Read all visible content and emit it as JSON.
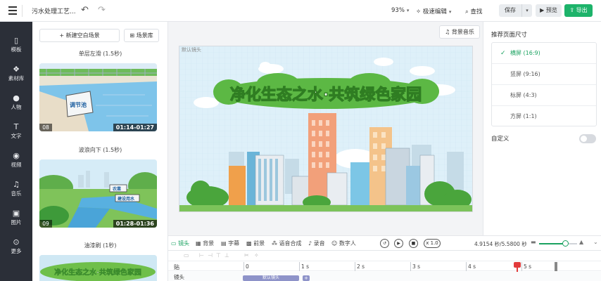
{
  "topbar": {
    "project_title": "污水处理工艺...",
    "undo_icon": "undo-icon",
    "redo_icon": "redo-icon",
    "zoom": "93%",
    "edit_mode": "极速编辑",
    "find": "查找",
    "save": "保存",
    "preview": "预览",
    "export": "导出",
    "export_color": "#1db36a"
  },
  "leftnav": {
    "items": [
      {
        "label": "模板",
        "icon": "template-icon"
      },
      {
        "label": "素材库",
        "icon": "material-library-icon"
      },
      {
        "label": "人物",
        "icon": "person-icon"
      },
      {
        "label": "文字",
        "icon": "text-icon"
      },
      {
        "label": "视频",
        "icon": "video-icon"
      },
      {
        "label": "音乐",
        "icon": "music-icon"
      },
      {
        "label": "图片",
        "icon": "image-icon"
      },
      {
        "label": "更多",
        "icon": "more-icon"
      }
    ]
  },
  "scenes": {
    "new_scene": "新建空白场景",
    "scene_library": "场景库",
    "transitions": [
      "单层左滑 (1.5秒)",
      "波浪向下 (1.5秒)",
      "油漆刷 (1秒)"
    ],
    "thumbs": [
      {
        "num": "08",
        "time": "01:14-01:27",
        "sign": "调节池"
      },
      {
        "num": "09",
        "time": "01:28-01:36",
        "sign1": "农業",
        "sign2": "建设用水"
      },
      {
        "banner": "净化生态之水·共筑绿色家园"
      }
    ]
  },
  "canvas": {
    "bgm": "背景音乐",
    "shot_label": "默认镜头",
    "banner": "净化生态之水·共筑绿色家园"
  },
  "rightpanel": {
    "title": "推荐页面尺寸",
    "ratios": [
      {
        "label": "横屏 (16:9)",
        "selected": true
      },
      {
        "label": "竖屏 (9:16)",
        "selected": false
      },
      {
        "label": "标屏 (4:3)",
        "selected": false
      },
      {
        "label": "方屏 (1:1)",
        "selected": false
      }
    ],
    "custom": "自定义",
    "custom_enabled": false
  },
  "toolbar": {
    "items": [
      "镜头",
      "背景",
      "字幕",
      "前景",
      "语音合成",
      "录音",
      "数字人"
    ],
    "speed": "x 1.0",
    "time": "4.9154 秒/5.5800 秒",
    "zoom_level": 0.7
  },
  "timeline": {
    "ruler_head": "贴",
    "ticks": [
      "0",
      "1 s",
      "2 s",
      "3 s",
      "4 s",
      "5 s"
    ],
    "track_label": "镜头",
    "clip_label": "默认镜头",
    "playhead_seconds": 4.9154,
    "total_seconds": 5.58
  }
}
